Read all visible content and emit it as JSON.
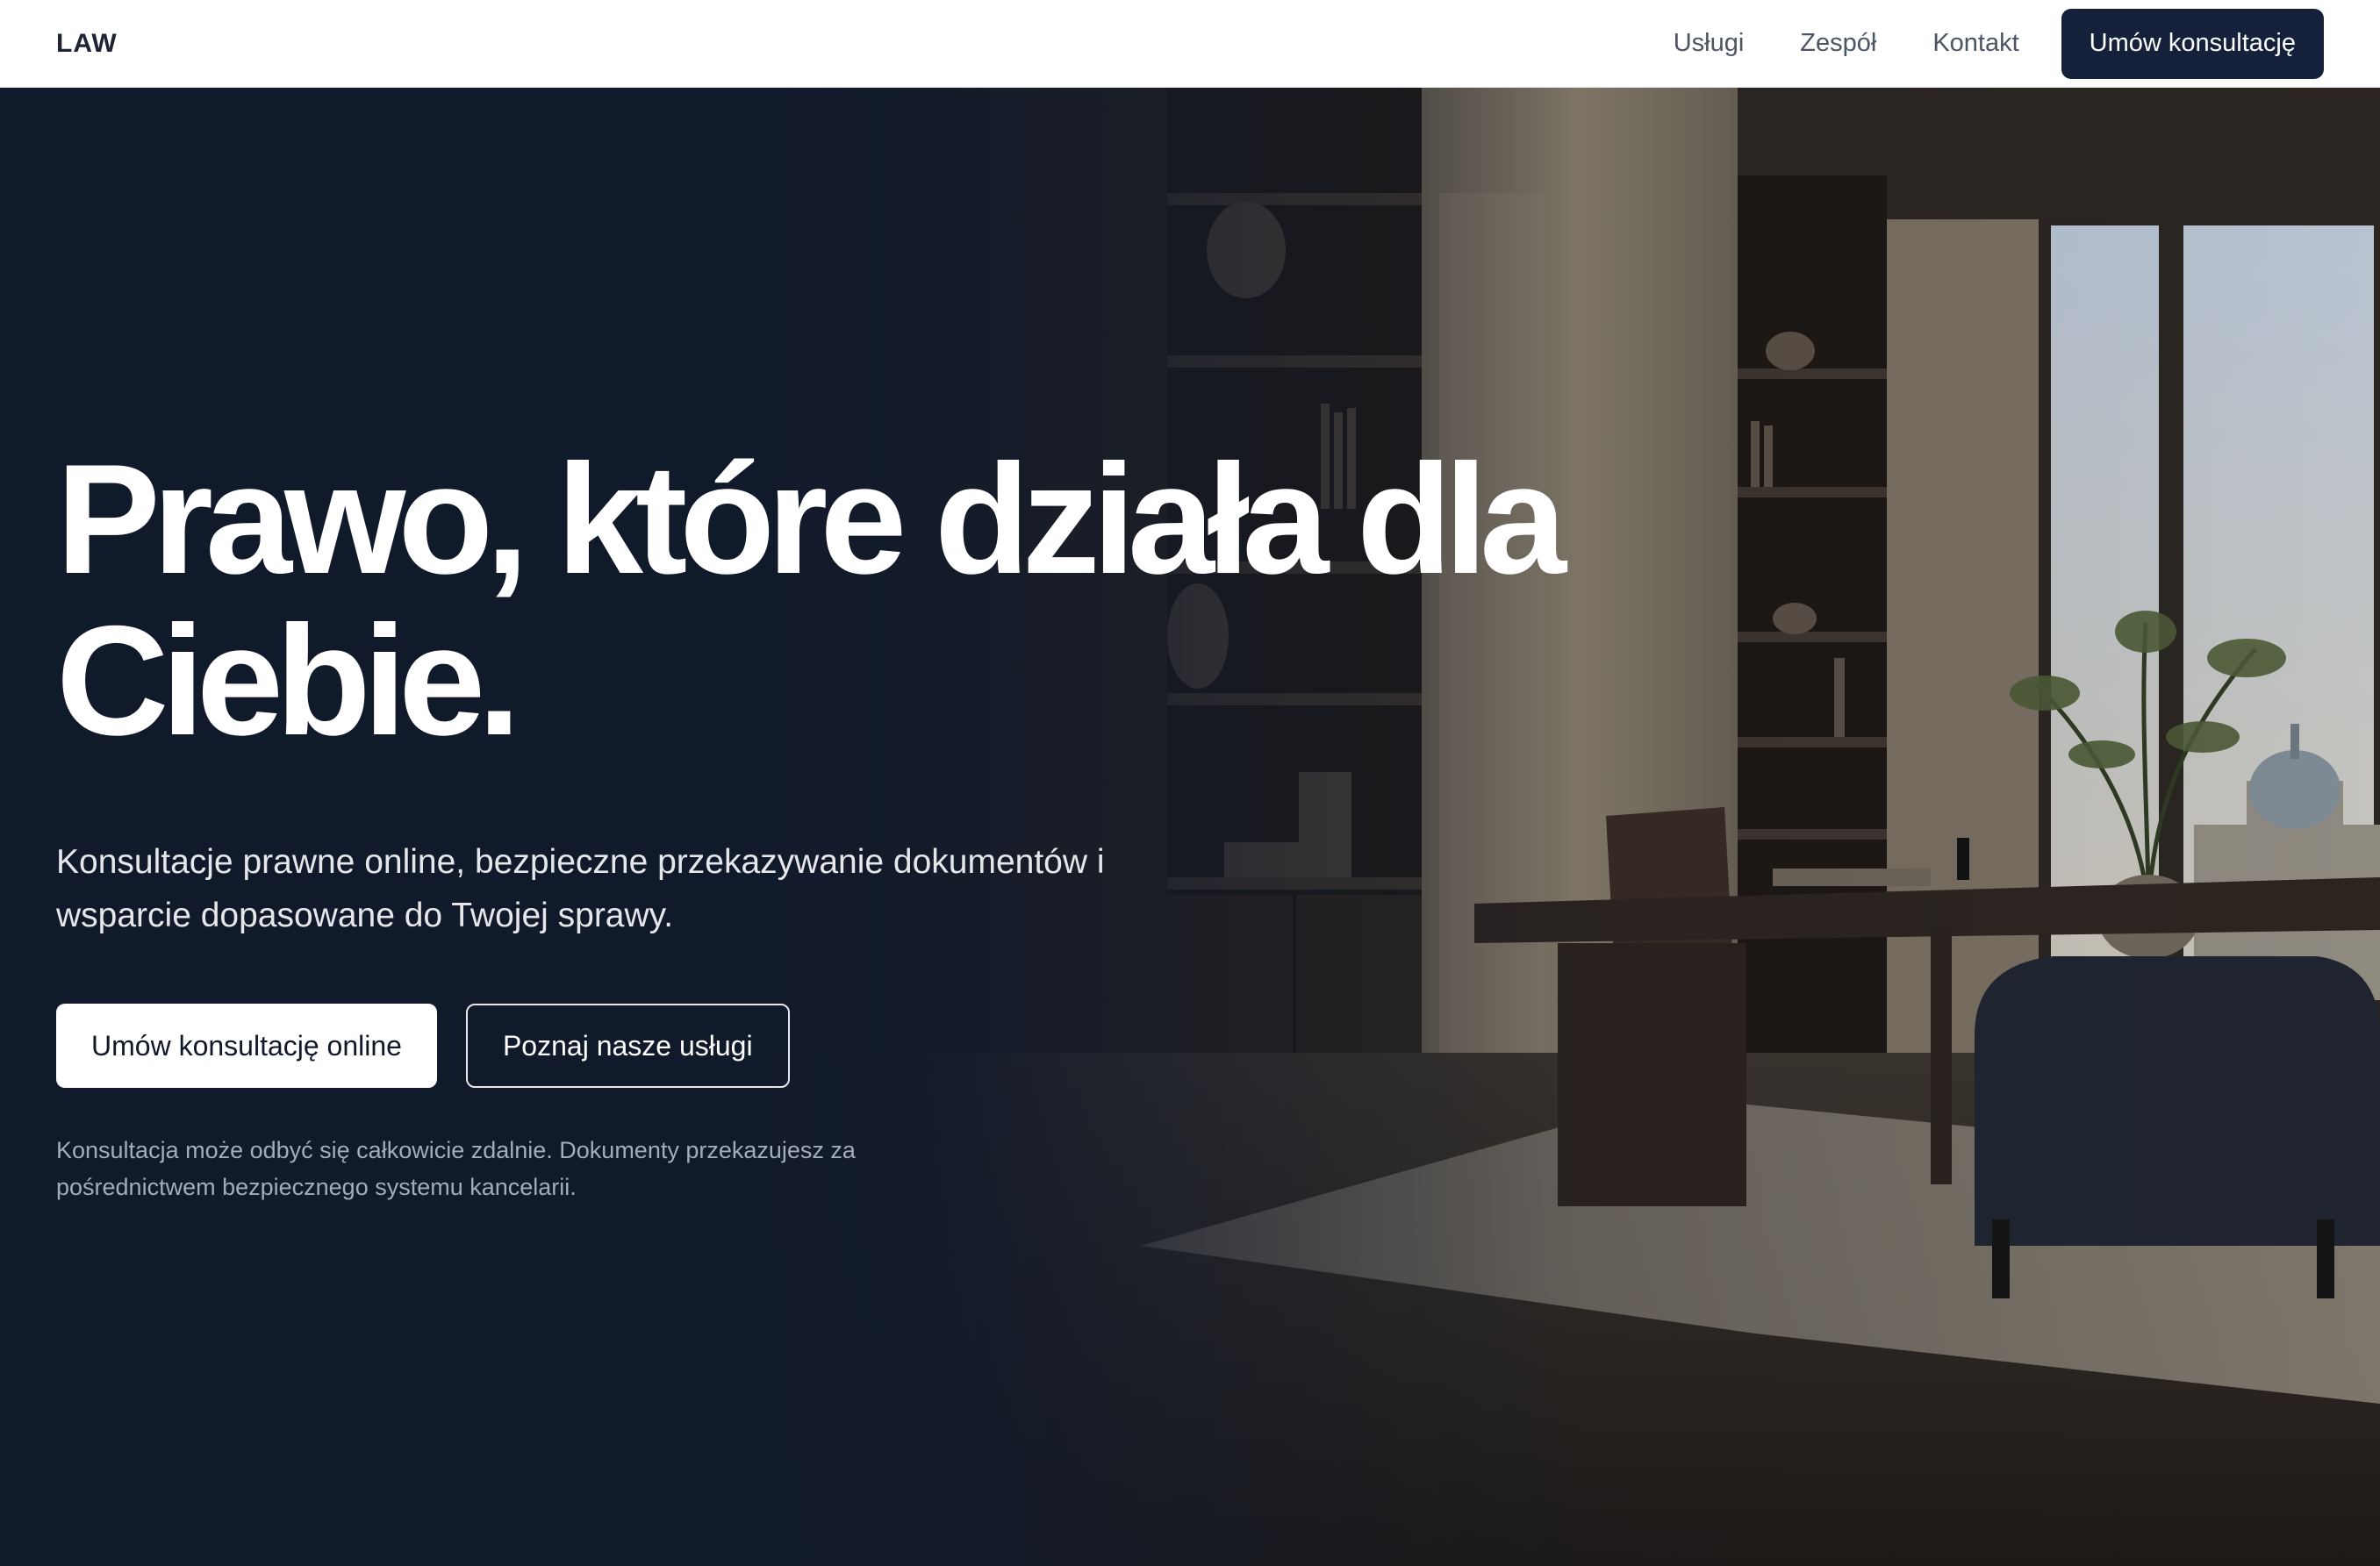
{
  "nav": {
    "logo": "LAW",
    "links": [
      "Usługi",
      "Zespół",
      "Kontakt"
    ],
    "cta_label": "Umów konsultację"
  },
  "hero": {
    "headline": "Prawo, które działa dla Ciebie.",
    "subline": "Konsultacje prawne online, bezpieczne przekazywanie dokumentów i wsparcie dopasowane do Twojej sprawy.",
    "primary_button": "Umów konsultację online",
    "secondary_button": "Poznaj nasze usługi",
    "note": "Konsultacja może odbyć się całkowicie zdalnie. Dokumenty przekazujesz za pośrednictwem bezpiecznego systemu kancelarii."
  },
  "colors": {
    "navy": "#15213a",
    "hero_bg": "#111a2b",
    "white": "#ffffff",
    "muted_text": "#a3acbb"
  }
}
